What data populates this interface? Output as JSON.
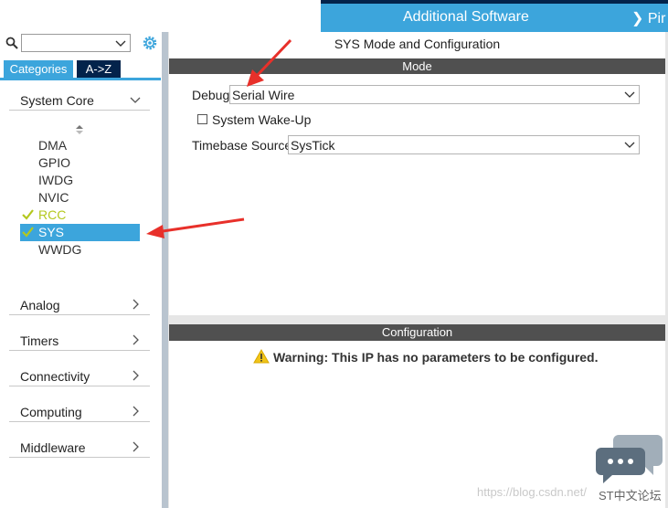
{
  "header": {
    "title": "Additional Software",
    "next_tab": "Pir"
  },
  "sidebar": {
    "search": {
      "value": ""
    },
    "tabs": [
      "Categories",
      "A->Z"
    ],
    "categories": [
      {
        "label": "System Core",
        "expanded": true
      },
      {
        "label": "Analog"
      },
      {
        "label": "Timers"
      },
      {
        "label": "Connectivity"
      },
      {
        "label": "Computing"
      },
      {
        "label": "Middleware"
      }
    ],
    "peripherals": [
      {
        "label": "DMA",
        "status": "none"
      },
      {
        "label": "GPIO",
        "status": "none"
      },
      {
        "label": "IWDG",
        "status": "none"
      },
      {
        "label": "NVIC",
        "status": "none"
      },
      {
        "label": "RCC",
        "status": "configured"
      },
      {
        "label": "SYS",
        "status": "selected"
      },
      {
        "label": "WWDG",
        "status": "none"
      }
    ]
  },
  "main": {
    "title": "SYS Mode and Configuration",
    "mode_header": "Mode",
    "debug": {
      "label": "Debug",
      "value": "Serial Wire"
    },
    "wakeup": {
      "label": "System Wake-Up",
      "checked": false
    },
    "timebase": {
      "label": "Timebase Source",
      "value": "SysTick"
    },
    "config_header": "Configuration",
    "warning": "Warning: This IP has no parameters to be configured."
  },
  "watermark": {
    "url": "https://blog.csdn.net/",
    "site": "ST中文论坛"
  },
  "colors": {
    "accent": "#3ca5dc",
    "dark": "#03234b",
    "configured": "#b4c81e",
    "header_bar": "#505050",
    "annotation_arrow": "#e8302a"
  }
}
